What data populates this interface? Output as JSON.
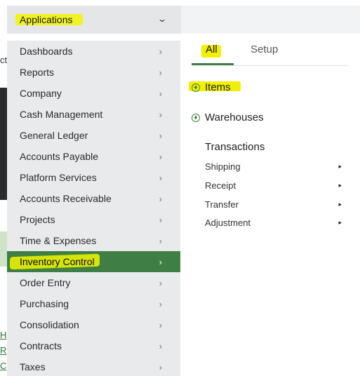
{
  "background": {
    "fragment_text": "ct",
    "side_letters": [
      "H",
      "R",
      "C"
    ]
  },
  "topbar": {
    "applications_label": "Applications",
    "chevron_icon": "chevron-down-icon"
  },
  "menu": {
    "items": [
      {
        "label": "Dashboards"
      },
      {
        "label": "Reports"
      },
      {
        "label": "Company"
      },
      {
        "label": "Cash Management"
      },
      {
        "label": "General Ledger"
      },
      {
        "label": "Accounts Payable"
      },
      {
        "label": "Platform Services"
      },
      {
        "label": "Accounts Receivable"
      },
      {
        "label": "Projects"
      },
      {
        "label": "Time & Expenses"
      },
      {
        "label": "Inventory Control",
        "active": true
      },
      {
        "label": "Order Entry"
      },
      {
        "label": "Purchasing"
      },
      {
        "label": "Consolidation"
      },
      {
        "label": "Contracts"
      },
      {
        "label": "Taxes"
      }
    ],
    "chevron": "›",
    "active_color": "#3f7f45"
  },
  "panel": {
    "tabs": {
      "all": "All",
      "setup": "Setup"
    },
    "categories": {
      "items": "Items",
      "warehouses": "Warehouses"
    },
    "section_title": "Transactions",
    "sub_items": [
      "Shipping",
      "Receipt",
      "Transfer",
      "Adjustment"
    ],
    "arrow": "▸"
  },
  "colors": {
    "accent": "#3f7f45",
    "highlight": "#f0f000"
  }
}
